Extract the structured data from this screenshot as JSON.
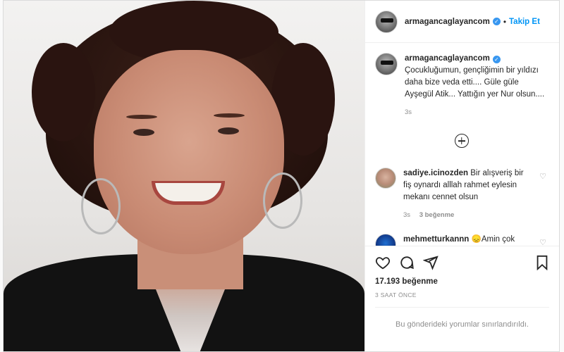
{
  "post": {
    "username": "armagancaglayancom",
    "follow_label": "Takip Et",
    "dot": "•",
    "caption": "Çocukluğumun, gençliğimin bir yıldızı daha bize veda etti.... Güle güle Ayşegül Atik... Yattığın yer Nur olsun....",
    "caption_time": "3s"
  },
  "comments": [
    {
      "username": "sadiye.icinozden",
      "text": "Bir alışveriş bir fiş oynardı alllah rahmet eylesin mekanı cennet olsun",
      "time": "3s",
      "likes": "3 beğenme"
    },
    {
      "username": "mehmetturkannn",
      "text": "😞Amin çok severdim ne kadar pozitif sempatik naif bir sanatçıydı 😞 Allah rahmet eylesin mekanı",
      "time": "",
      "likes": ""
    }
  ],
  "footer": {
    "likes_count": "17.193",
    "likes_label": "beğenme",
    "timestamp": "3 SAAT ÖNCE",
    "restricted_text": "Bu gönderideki yorumlar sınırlandırıldı."
  },
  "icons": [
    "heart-icon",
    "comment-icon",
    "share-icon",
    "bookmark-icon",
    "add-comment-icon",
    "verified-badge-icon"
  ],
  "colors": {
    "accent": "#0095f6",
    "verified": "#3897f0",
    "text": "#262626",
    "muted": "#8e8e8e"
  }
}
